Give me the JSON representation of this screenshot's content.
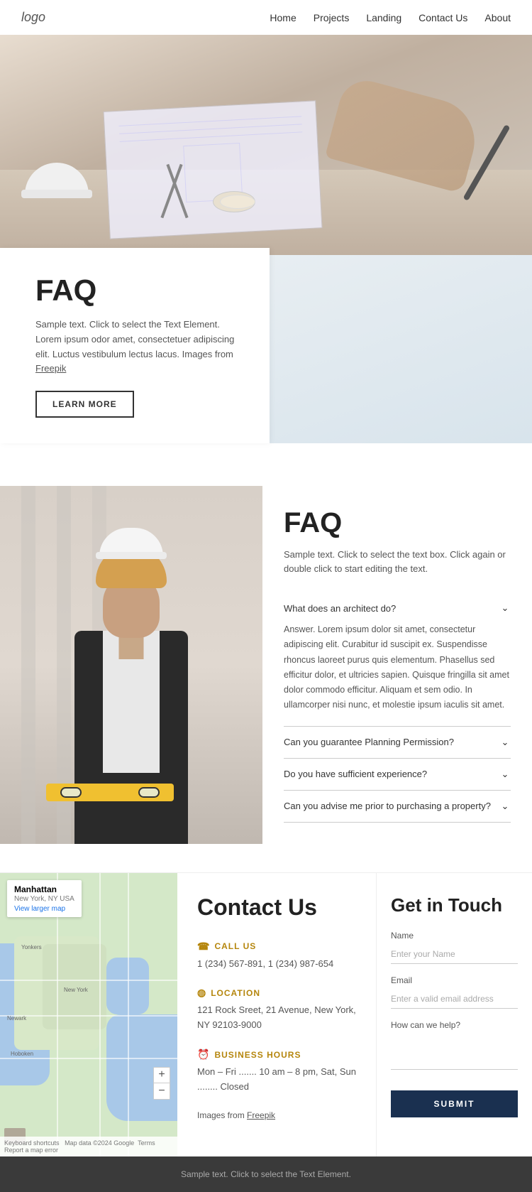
{
  "nav": {
    "logo": "logo",
    "links": [
      {
        "label": "Home",
        "href": "#"
      },
      {
        "label": "Projects",
        "href": "#"
      },
      {
        "label": "Landing",
        "href": "#"
      },
      {
        "label": "Contact Us",
        "href": "#"
      },
      {
        "label": "About",
        "href": "#"
      }
    ]
  },
  "faq1": {
    "title": "FAQ",
    "description": "Sample text. Click to select the Text Element. Lorem ipsum odor amet, consectetuer adipiscing elit. Luctus vestibulum lectus lacus. Images from",
    "freepik_link": "Freepik",
    "button": "LEARN MORE"
  },
  "faq2": {
    "title": "FAQ",
    "subtitle": "Sample text. Click to select the text box. Click again or double click to start editing the text.",
    "items": [
      {
        "question": "What does an architect do?",
        "answer": "Answer. Lorem ipsum dolor sit amet, consectetur adipiscing elit. Curabitur id suscipit ex. Suspendisse rhoncus laoreet purus quis elementum. Phasellus sed efficitur dolor, et ultricies sapien. Quisque fringilla sit amet dolor commodo efficitur. Aliquam et sem odio. In ullamcorper nisi nunc, et molestie ipsum iaculis sit amet.",
        "open": true
      },
      {
        "question": "Can you guarantee Planning Permission?",
        "answer": "",
        "open": false
      },
      {
        "question": "Do you have sufficient experience?",
        "answer": "",
        "open": false
      },
      {
        "question": "Can you advise me prior to purchasing a property?",
        "answer": "",
        "open": false
      }
    ]
  },
  "contact": {
    "title": "Contact Us",
    "phone_label": "CALL US",
    "phone": "1 (234) 567-891, 1 (234) 987-654",
    "location_label": "LOCATION",
    "address": "121 Rock Sreet, 21 Avenue, New York, NY 92103-9000",
    "hours_label": "BUSINESS HOURS",
    "hours": "Mon – Fri ....... 10 am – 8 pm, Sat, Sun ........ Closed",
    "images_text": "Images from",
    "freepik_link": "Freepik"
  },
  "get_in_touch": {
    "title": "Get in Touch",
    "name_label": "Name",
    "name_placeholder": "Enter your Name",
    "email_label": "Email",
    "email_placeholder": "Enter a valid email address",
    "message_label": "How can we help?",
    "message_placeholder": "",
    "submit": "SUBMIT"
  },
  "map": {
    "location": "Manhattan",
    "sublocation": "New York, NY USA",
    "larger_map": "View larger map"
  },
  "footer": {
    "text": "Sample text. Click to select the Text Element."
  }
}
